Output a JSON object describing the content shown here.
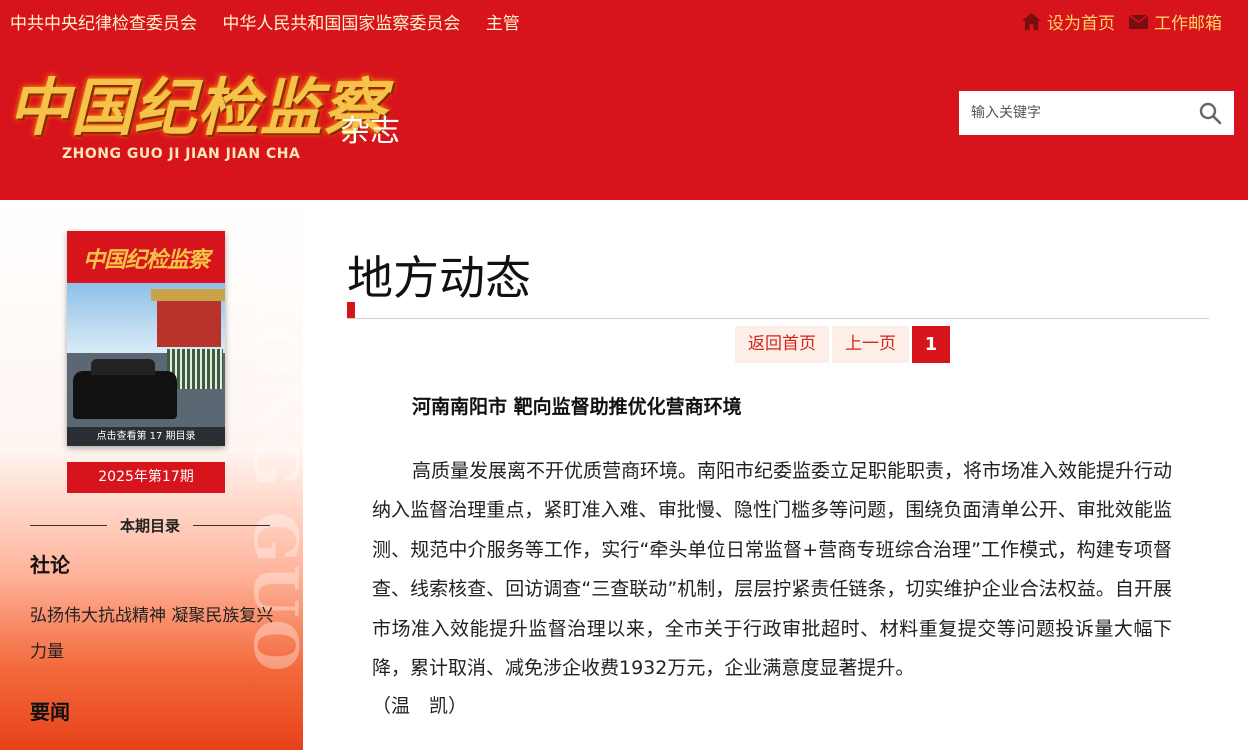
{
  "top_bar": {
    "supervisors": [
      "中共中央纪律检查委员会",
      "中华人民共和国国家监察委员会",
      "主管"
    ],
    "set_homepage": "设为首页",
    "work_mail": "工作邮箱"
  },
  "logo": {
    "name_cn": "中国纪检监察",
    "suffix": "杂志",
    "pinyin": "ZHONG GUO JI JIAN JIAN CHA"
  },
  "search": {
    "placeholder": "输入关键字"
  },
  "sidebar": {
    "watermark": "ZHONG GUO",
    "cover": {
      "title": "中国纪检监察",
      "caption": "点击查看第 17 期目录"
    },
    "issue_label": "2025年第17期",
    "toc_header": "本期目录",
    "sections": [
      {
        "title": "社论",
        "items": [
          "弘扬伟大抗战精神 凝聚民族复兴力量"
        ]
      },
      {
        "title": "要闻",
        "items": []
      }
    ]
  },
  "main": {
    "page_title": "地方动态",
    "pager": {
      "home": "返回首页",
      "prev": "上一页",
      "current": "1"
    },
    "article": {
      "title": "河南南阳市  靶向监督助推优化营商环境",
      "body": "高质量发展离不开优质营商环境。南阳市纪委监委立足职能职责，将市场准入效能提升行动纳入监督治理重点，紧盯准入难、审批慢、隐性门槛多等问题，围绕负面清单公开、审批效能监测、规范中介服务等工作，实行“牵头单位日常监督+营商专班综合治理”工作模式，构建专项督查、线索核查、回访调查“三查联动”机制，层层拧紧责任链条，切实维护企业合法权益。自开展市场准入效能提升监督治理以来，全市关于行政审批超时、材料重复提交等问题投诉量大幅下降，累计取消、减免涉企收费1932万元，企业满意度显著提升。",
      "author": "（温　凯）"
    }
  },
  "colors": {
    "brand_red": "#d7141b",
    "gold": "#f5c24a",
    "link_gold": "#ffd36a"
  }
}
